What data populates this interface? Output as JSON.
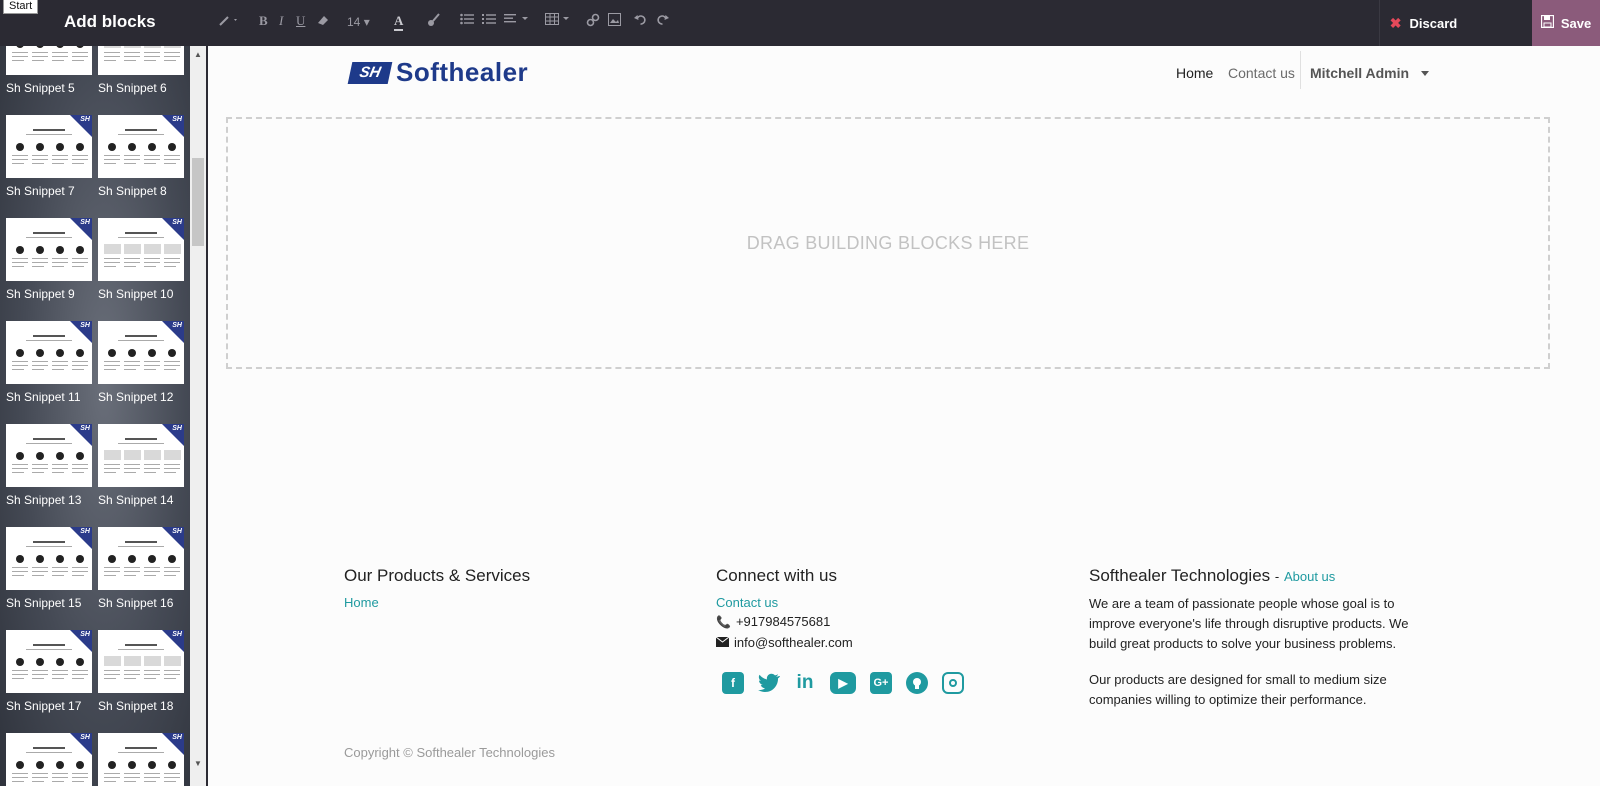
{
  "tooltip": {
    "start": "Start"
  },
  "header": {
    "title": "Add blocks",
    "font_size": "14",
    "discard_label": "Discard",
    "save_label": "Save",
    "accent_save": "#8b5b7b",
    "accent_discard_icon": "#e5495a"
  },
  "sidebar": {
    "snippets": [
      {
        "label": "Sh Snippet 5"
      },
      {
        "label": "Sh Snippet 6"
      },
      {
        "label": "Sh Snippet 7"
      },
      {
        "label": "Sh Snippet 8"
      },
      {
        "label": "Sh Snippet 9"
      },
      {
        "label": "Sh Snippet 10"
      },
      {
        "label": "Sh Snippet 11"
      },
      {
        "label": "Sh Snippet 12"
      },
      {
        "label": "Sh Snippet 13"
      },
      {
        "label": "Sh Snippet 14"
      },
      {
        "label": "Sh Snippet 15"
      },
      {
        "label": "Sh Snippet 16"
      },
      {
        "label": "Sh Snippet 17"
      },
      {
        "label": "Sh Snippet 18"
      },
      {
        "label": ""
      },
      {
        "label": ""
      }
    ]
  },
  "site": {
    "logo_mark": "SH",
    "logo_text": "Softhealer",
    "nav": {
      "home": "Home",
      "contact": "Contact us",
      "user": "Mitchell Admin"
    },
    "dropzone_text": "DRAG BUILDING BLOCKS HERE",
    "footer": {
      "col1_title": "Our Products & Services",
      "col1_link": "Home",
      "col2_title": "Connect with us",
      "col2_link": "Contact us",
      "phone": "+917984575681",
      "email": "info@softhealer.com",
      "col3_title": "Softhealer Technologies",
      "col3_dash": "-",
      "col3_link": "About us",
      "para1": "We are a team of passionate people whose goal is to improve everyone's life through disruptive products. We build great products to solve your business problems.",
      "para2": "Our products are designed for small to medium size companies willing to optimize their performance.",
      "copyright": "Copyright © Softhealer Technologies"
    },
    "social_icons": [
      "facebook-icon",
      "twitter-icon",
      "linkedin-icon",
      "youtube-icon",
      "google-plus-icon",
      "github-icon",
      "instagram-icon"
    ],
    "accent_link": "#1f9aa0"
  }
}
